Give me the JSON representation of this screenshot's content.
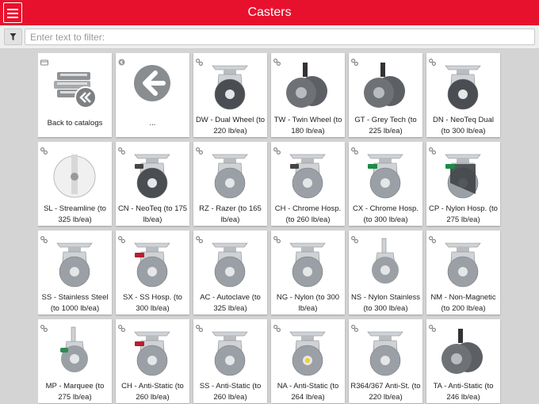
{
  "header": {
    "title": "Casters"
  },
  "filter": {
    "placeholder": "Enter text to filter:"
  },
  "tiles": [
    {
      "label": "Back to catalogs",
      "kind": "books",
      "icon": "folder-icon"
    },
    {
      "label": "...",
      "kind": "back",
      "icon": "back-icon"
    },
    {
      "label": "DW - Dual Wheel (to 220 lb/ea)",
      "kind": "dual",
      "icon": "link-icon"
    },
    {
      "label": "TW - Twin Wheel (to 180 lb/ea)",
      "kind": "twin",
      "icon": "link-icon"
    },
    {
      "label": "GT - Grey Tech (to 225 lb/ea)",
      "kind": "twin",
      "icon": "link-icon"
    },
    {
      "label": "DN - NeoTeq Dual (to 300 lb/ea)",
      "kind": "dual",
      "icon": "link-icon"
    },
    {
      "label": "SL - Streamline (to 325 lb/ea)",
      "kind": "white",
      "icon": "link-icon"
    },
    {
      "label": "CN - NeoTeq (to 175 lb/ea)",
      "kind": "brake",
      "icon": "link-icon"
    },
    {
      "label": "RZ - Razer (to 165 lb/ea)",
      "kind": "plain",
      "icon": "link-icon"
    },
    {
      "label": "CH - Chrome Hosp. (to 260 lb/ea)",
      "kind": "chrome-brake",
      "icon": "link-icon"
    },
    {
      "label": "CX - Chrome Hosp. (to 300 lb/ea)",
      "kind": "green-brake",
      "icon": "link-icon"
    },
    {
      "label": "CP - Nylon Hosp. (to 275 lb/ea)",
      "kind": "green-cover",
      "icon": "link-icon"
    },
    {
      "label": "SS - Stainless Steel (to 1000 lb/ea)",
      "kind": "plain",
      "icon": "link-icon"
    },
    {
      "label": "SX - SS Hosp. (to 300 lb/ea)",
      "kind": "red-brake",
      "icon": "link-icon"
    },
    {
      "label": "AC - Autoclave (to 325 lb/ea)",
      "kind": "plain",
      "icon": "link-icon"
    },
    {
      "label": "NG - Nylon (to 300 lb/ea)",
      "kind": "plain",
      "icon": "link-icon"
    },
    {
      "label": "NS - Nylon Stainless (to 300 lb/ea)",
      "kind": "stem",
      "icon": "link-icon"
    },
    {
      "label": "NM - Non-Magnetic (to 200 lb/ea)",
      "kind": "plain",
      "icon": "link-icon"
    },
    {
      "label": "MP - Marquee (to 275 lb/ea)",
      "kind": "stem-green",
      "icon": "link-icon"
    },
    {
      "label": "CH - Anti-Static (to 260 lb/ea)",
      "kind": "red-brake",
      "icon": "link-icon"
    },
    {
      "label": "SS - Anti-Static (to 260 lb/ea)",
      "kind": "plain",
      "icon": "link-icon"
    },
    {
      "label": "NA - Anti-Static (to 264 lb/ea)",
      "kind": "yellow",
      "icon": "link-icon"
    },
    {
      "label": "R364/367 Anti-St. (to 220 lb/ea)",
      "kind": "plain",
      "icon": "link-icon"
    },
    {
      "label": "TA - Anti-Static (to 246 lb/ea)",
      "kind": "twin",
      "icon": "link-icon"
    }
  ]
}
